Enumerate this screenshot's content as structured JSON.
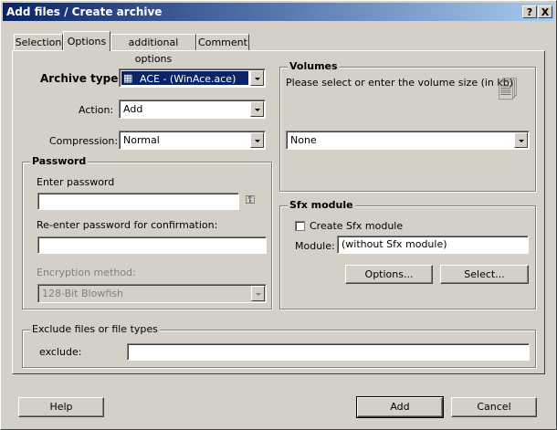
{
  "window": {
    "title": "Add files / Create archive",
    "help_btn": "?",
    "close_btn": "X"
  },
  "tabs": [
    {
      "label": "Selection"
    },
    {
      "label": "Options"
    },
    {
      "label": "additional options"
    },
    {
      "label": "Comment"
    }
  ],
  "archive": {
    "type_label": "Archive type:",
    "type_value": "ACE - (WinAce.ace)",
    "action_label": "Action:",
    "action_value": "Add",
    "compression_label": "Compression:",
    "compression_value": "Normal"
  },
  "password": {
    "group_title": "Password",
    "enter_label": "Enter password",
    "enter_value": "",
    "reenter_label": "Re-enter password for confirmation:",
    "reenter_value": "",
    "method_label": "Encryption method:",
    "method_value": "128-Bit Blowfish"
  },
  "volumes": {
    "group_title": "Volumes",
    "hint": "Please select or enter the volume size (in kb)",
    "value": "None"
  },
  "sfx": {
    "group_title": "Sfx module",
    "checkbox_label": "Create Sfx module",
    "module_label": "Module:",
    "module_value": "(without Sfx module)",
    "options_btn": "Options...",
    "select_btn": "Select..."
  },
  "exclude": {
    "group_title": "Exclude files or file types",
    "label": "exclude:",
    "value": ""
  },
  "buttons": {
    "help": "Help",
    "add": "Add",
    "cancel": "Cancel"
  },
  "colors": {
    "title_start": "#0a246a",
    "title_end": "#a6caf0",
    "face": "#d4d0c8",
    "selection": "#0a246a"
  }
}
